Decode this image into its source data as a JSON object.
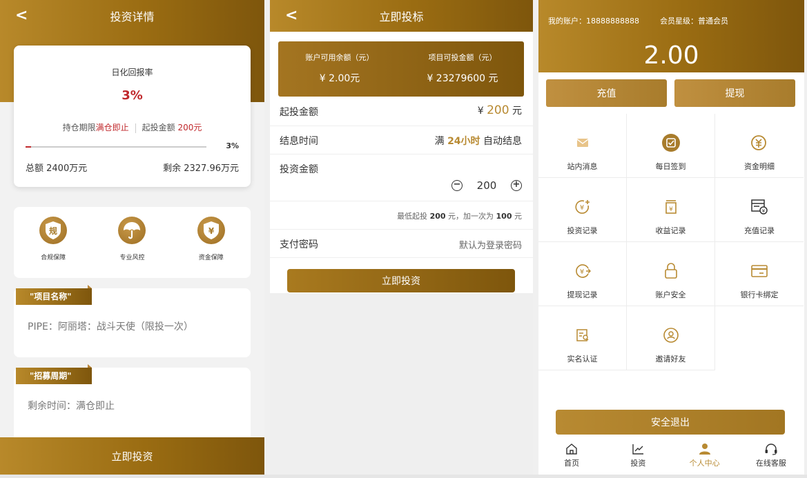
{
  "detail": {
    "title": "投资详情",
    "rate_title": "日化回报率",
    "rate_value": "3%",
    "term_label": "持仓期限",
    "term_value": "满仓即止",
    "min_label": "起投金额",
    "min_value": "200元",
    "progress_percent": 3,
    "progress_text": "3%",
    "total": "总额 2400万元",
    "remaining": "剩余 2327.96万元",
    "features": [
      {
        "label": "合规保障",
        "icon": "shield-gui-icon"
      },
      {
        "label": "专业风控",
        "icon": "umbrella-icon"
      },
      {
        "label": "资金保障",
        "icon": "shield-yuan-icon"
      }
    ],
    "project_tag": "\"项目名称\"",
    "project_name": "PIPE：阿丽塔：战斗天使（限投一次）",
    "cycle_tag": "\"招募周期\"",
    "cycle_value": "剩余时间：满仓即止",
    "invest_button": "立即投资"
  },
  "bid": {
    "title": "立即投标",
    "available_label": "账户可用余额（元）",
    "available_value": "¥ 2.00元",
    "project_amount_label": "项目可投金额（元）",
    "project_amount_value": "¥ 23279600 元",
    "min_label": "起投金额",
    "min_currency": "¥ ",
    "min_amount": "200",
    "min_unit": " 元",
    "interest_label": "结息时间",
    "interest_prefix": "满 ",
    "interest_hours": "24小时",
    "interest_suffix": " 自动结息",
    "amount_label": "投资金额",
    "amount_value": "200",
    "hint_a": "最低起投 ",
    "hint_min": "200",
    "hint_b": " 元，加一次为 ",
    "hint_step": "100",
    "hint_c": " 元",
    "password_label": "支付密码",
    "password_placeholder": "默认为登录密码",
    "invest_button": "立即投资"
  },
  "account": {
    "account_line": "我的账户：18888888888",
    "level_line": "会员星级：普通会员",
    "balance": "2.00",
    "recharge_button": "充值",
    "withdraw_button": "提现",
    "menu": [
      {
        "label": "站内消息",
        "icon": "mail-icon"
      },
      {
        "label": "每日签到",
        "icon": "checkin-icon"
      },
      {
        "label": "资金明细",
        "icon": "fund-detail-icon"
      },
      {
        "label": "投资记录",
        "icon": "invest-record-icon"
      },
      {
        "label": "收益记录",
        "icon": "income-record-icon"
      },
      {
        "label": "充值记录",
        "icon": "recharge-record-icon"
      },
      {
        "label": "提现记录",
        "icon": "withdraw-record-icon"
      },
      {
        "label": "账户安全",
        "icon": "lock-icon"
      },
      {
        "label": "银行卡绑定",
        "icon": "bank-card-icon"
      },
      {
        "label": "实名认证",
        "icon": "id-card-icon"
      },
      {
        "label": "邀请好友",
        "icon": "invite-icon"
      }
    ],
    "logout_button": "安全退出",
    "tabs": [
      {
        "label": "首页",
        "icon": "home-icon"
      },
      {
        "label": "投资",
        "icon": "chart-icon"
      },
      {
        "label": "个人中心",
        "icon": "user-icon",
        "active": true
      },
      {
        "label": "在线客服",
        "icon": "headset-icon"
      }
    ]
  },
  "colors": {
    "gold": "#a87c2c",
    "red": "#c0282c"
  }
}
